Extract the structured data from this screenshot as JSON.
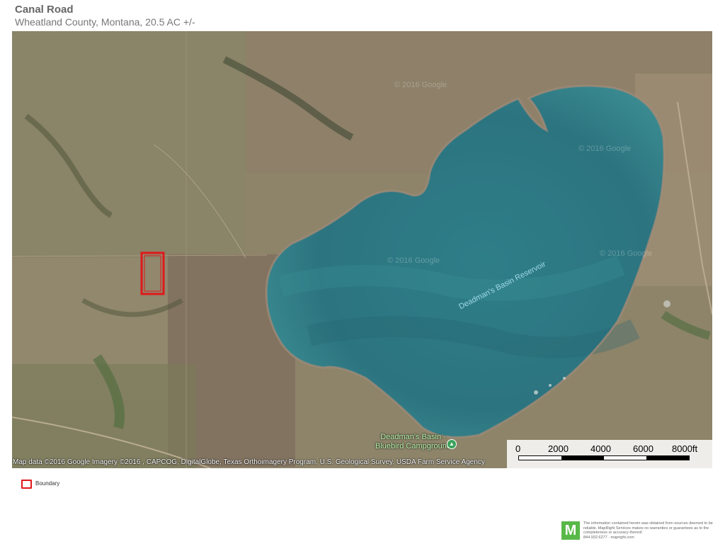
{
  "header": {
    "title": "Canal Road",
    "subtitle": "Wheatland County, Montana, 20.5  AC +/-"
  },
  "map": {
    "reservoir_label": "Deadman's Basin Reservoir",
    "watermark": "© 2016 Google",
    "campground_label_line1": "Deadman's Basin -",
    "campground_label_line2": "Bluebird Campground",
    "attribution": "Map data ©2016 Google  Imagery ©2016 , CAPCOG, DigitalGlobe, Texas Orthoimagery Program, U.S. Geological Survey, USDA Farm Service Agency",
    "water_color": "#2f7f88",
    "boundary_color": "#e0191b",
    "scale": {
      "labels": [
        "0",
        "2000",
        "4000",
        "6000",
        "8000ft"
      ]
    }
  },
  "legend": {
    "boundary_label": "Boundary"
  },
  "footer": {
    "logo_letter": "M",
    "disclaimer": "The information contained herein was obtained from sources deemed to be reliable. MapRight Services makes no warranties or guarantees as to the completeness or accuracy thereof.",
    "contact": "844.932.6277 · mapright.com"
  }
}
